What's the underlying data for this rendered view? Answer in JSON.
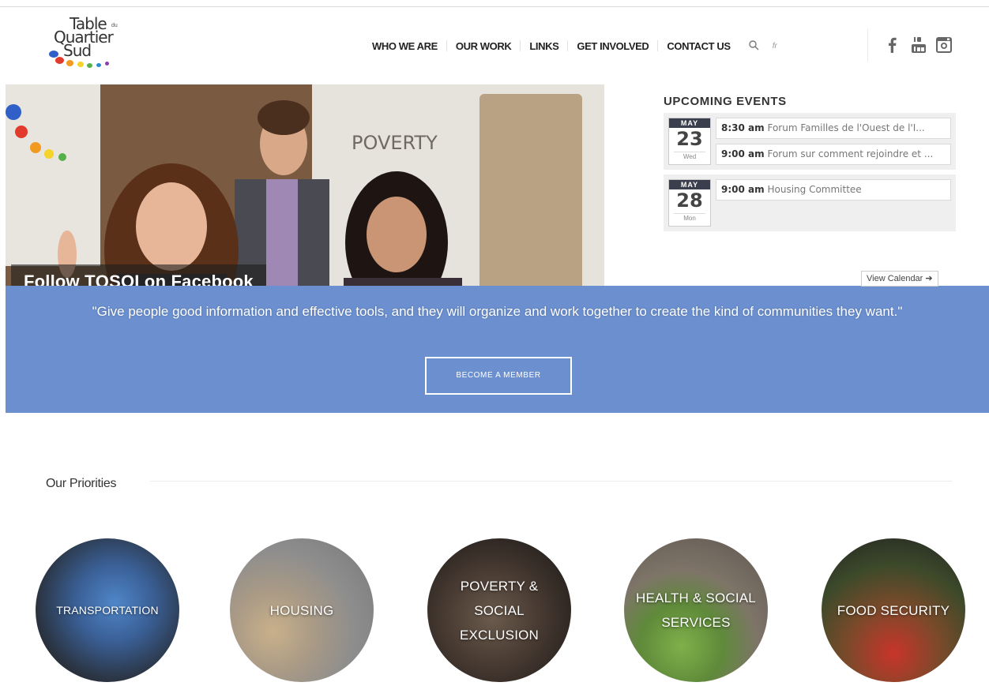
{
  "header": {
    "logo": {
      "line1": "Table",
      "du": "du",
      "line2": "Quartier",
      "line3": "Sud"
    },
    "nav": [
      "WHO WE ARE",
      "OUR WORK",
      "LINKS",
      "GET INVOLVED",
      "CONTACT US"
    ],
    "lang": "fr",
    "icons": [
      "search-icon",
      "facebook-icon",
      "youtube-icon",
      "instagram-icon"
    ]
  },
  "hero": {
    "facebook_label": "Follow TQSOI on Facebook",
    "poster_text": "POVERTY"
  },
  "events": {
    "title": "UPCOMING EVENTS",
    "days": [
      {
        "month": "MAY",
        "day": "23",
        "weekday": "Wed",
        "items": [
          {
            "time": "8:30 am",
            "text": "Forum Familles de l'Ouest de l'I..."
          },
          {
            "time": "9:00 am",
            "text": "Forum sur comment rejoindre et ..."
          }
        ]
      },
      {
        "month": "MAY",
        "day": "28",
        "weekday": "Mon",
        "items": [
          {
            "time": "9:00 am",
            "text": "Housing Committee"
          }
        ]
      }
    ],
    "view_calendar": "View Calendar ➔"
  },
  "band": {
    "quote": "\"Give people good information and effective tools, and they will organize and work together to create the kind of communities they want.\"",
    "button": "BECOME A MEMBER"
  },
  "priorities": {
    "title": "Our Priorities",
    "items": [
      "TRANSPORTATION",
      "HOUSING",
      "POVERTY & SOCIAL EXCLUSION",
      "HEALTH & SOCIAL SERVICES",
      "FOOD SECURITY"
    ]
  },
  "colors": {
    "band": "#6b8fcf",
    "calendar_header": "#3b3f4d"
  }
}
